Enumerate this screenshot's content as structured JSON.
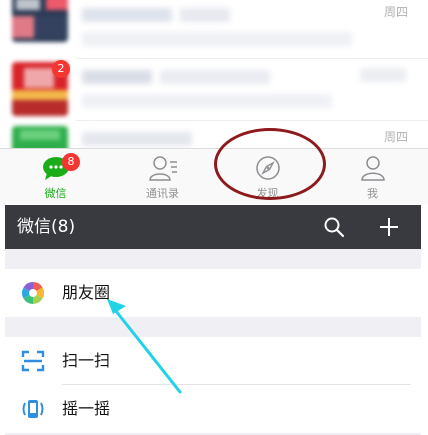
{
  "chat_list": {
    "rows": [
      {
        "time": "周四"
      },
      {
        "unread": "2"
      },
      {
        "time": "周四"
      }
    ]
  },
  "tabbar": {
    "tabs": [
      {
        "label": "微信",
        "icon": "chat-bubble-icon",
        "badge": "8",
        "active": true
      },
      {
        "label": "通讯录",
        "icon": "contacts-icon"
      },
      {
        "label": "发现",
        "icon": "compass-icon"
      },
      {
        "label": "我",
        "icon": "person-icon"
      }
    ]
  },
  "header": {
    "title": "微信(8)",
    "icons": [
      "search-icon",
      "plus-icon"
    ]
  },
  "discover": {
    "items": [
      {
        "label": "朋友圈",
        "icon": "moments-aperture-icon"
      },
      {
        "label": "扫一扫",
        "icon": "scan-icon"
      },
      {
        "label": "摇一摇",
        "icon": "shake-icon"
      }
    ]
  },
  "colors": {
    "accent_green": "#1aad19",
    "badge_red": "#f43530",
    "nav_dark": "#393a3f",
    "annotation_circle": "#8e1a1e",
    "annotation_arrow": "#22d3e6"
  }
}
